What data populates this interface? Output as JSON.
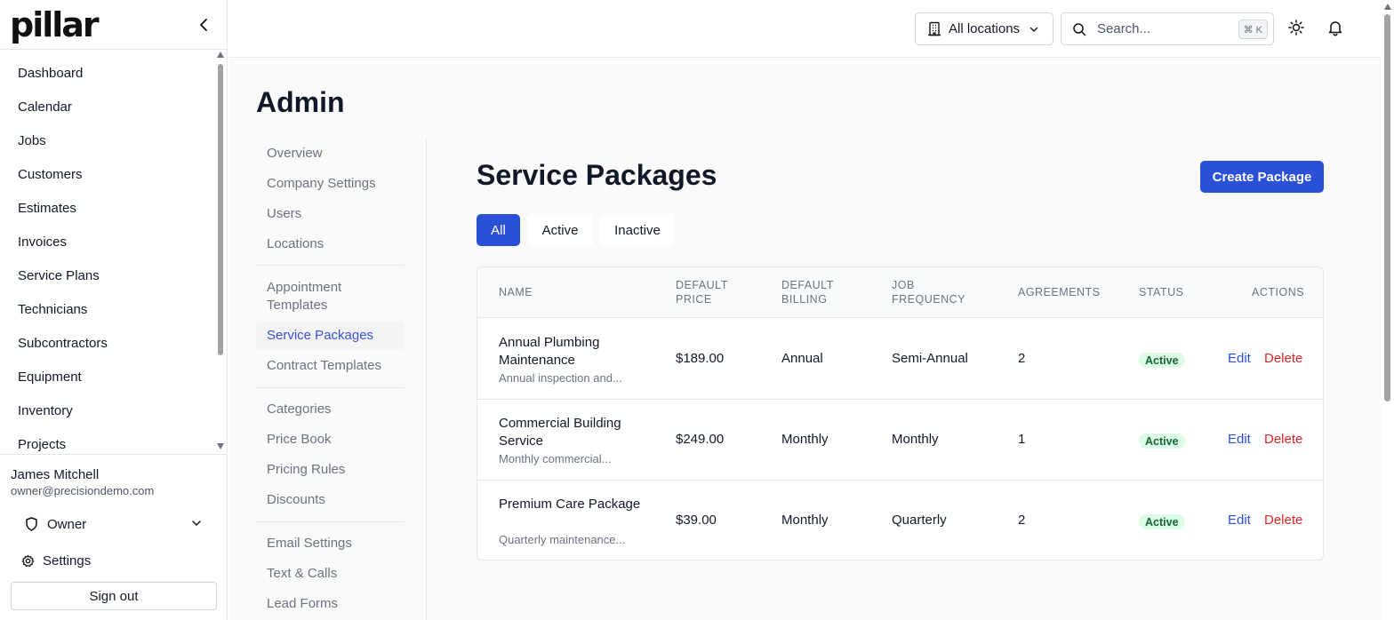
{
  "brand": {
    "logo_text": "pillar"
  },
  "sidebar": {
    "items": [
      {
        "label": "Dashboard"
      },
      {
        "label": "Calendar"
      },
      {
        "label": "Jobs"
      },
      {
        "label": "Customers"
      },
      {
        "label": "Estimates"
      },
      {
        "label": "Invoices"
      },
      {
        "label": "Service Plans"
      },
      {
        "label": "Technicians"
      },
      {
        "label": "Subcontractors"
      },
      {
        "label": "Equipment"
      },
      {
        "label": "Inventory"
      },
      {
        "label": "Projects"
      }
    ],
    "user": {
      "name": "James Mitchell",
      "email": "owner@precisiondemo.com",
      "role": "Owner",
      "settings_label": "Settings",
      "signout_label": "Sign out"
    }
  },
  "topbar": {
    "location": "All locations",
    "search_placeholder": "Search...",
    "shortcut": "⌘ K"
  },
  "admin": {
    "title": "Admin",
    "subnav": [
      {
        "label": "Overview"
      },
      {
        "label": "Company Settings"
      },
      {
        "label": "Users"
      },
      {
        "label": "Locations"
      },
      {
        "label": "Appointment Templates"
      },
      {
        "label": "Service Packages"
      },
      {
        "label": "Contract Templates"
      },
      {
        "label": "Categories"
      },
      {
        "label": "Price Book"
      },
      {
        "label": "Pricing Rules"
      },
      {
        "label": "Discounts"
      },
      {
        "label": "Email Settings"
      },
      {
        "label": "Text & Calls"
      },
      {
        "label": "Lead Forms"
      }
    ],
    "active_subnav": "Service Packages"
  },
  "packages": {
    "title": "Service Packages",
    "create_label": "Create Package",
    "filters": [
      "All",
      "Active",
      "Inactive"
    ],
    "active_filter": "All",
    "columns": {
      "name": "NAME",
      "default_price": "DEFAULT PRICE",
      "default_billing": "DEFAULT BILLING",
      "job_frequency": "JOB FREQUENCY",
      "agreements": "AGREEMENTS",
      "status": "STATUS",
      "actions": "ACTIONS"
    },
    "rows": [
      {
        "name": "Annual Plumbing Maintenance",
        "description": "Annual inspection and...",
        "price": "$189.00",
        "billing": "Annual",
        "frequency": "Semi-Annual",
        "agreements": "2",
        "status": "Active",
        "edit": "Edit",
        "delete": "Delete"
      },
      {
        "name": "Commercial Building Service",
        "description": "Monthly commercial...",
        "price": "$249.00",
        "billing": "Monthly",
        "frequency": "Monthly",
        "agreements": "1",
        "status": "Active",
        "edit": "Edit",
        "delete": "Delete"
      },
      {
        "name": "Premium Care Package",
        "description": "Quarterly maintenance...",
        "price": "$39.00",
        "billing": "Monthly",
        "frequency": "Quarterly",
        "agreements": "2",
        "status": "Active",
        "edit": "Edit",
        "delete": "Delete"
      }
    ]
  },
  "colors": {
    "accent": "#2b50d8",
    "danger": "#dc2626",
    "active_badge_bg": "#dcfce7",
    "active_badge_text": "#166534"
  }
}
